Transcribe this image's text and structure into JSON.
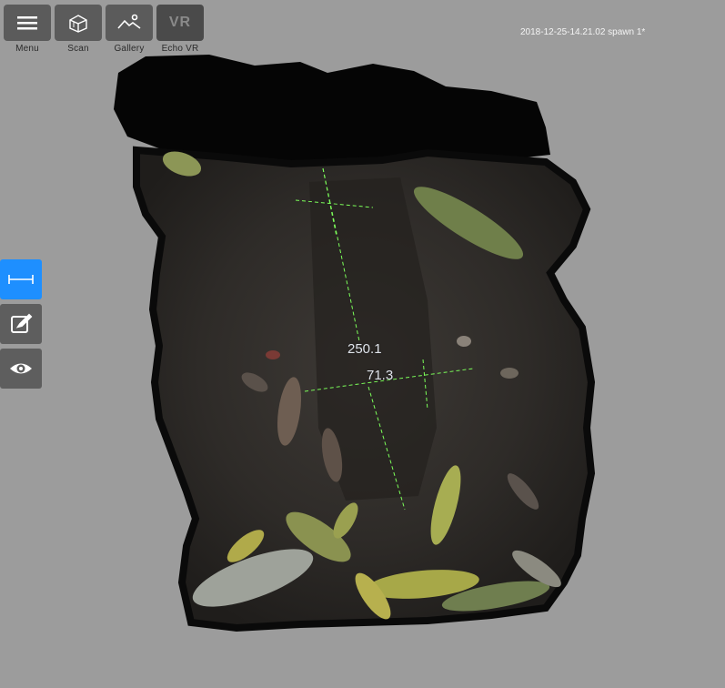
{
  "toolbar": {
    "items": [
      {
        "label": "Menu",
        "icon": "hamburger-menu-icon"
      },
      {
        "label": "Scan",
        "icon": "cube-scan-icon"
      },
      {
        "label": "Gallery",
        "icon": "gallery-landscape-icon"
      },
      {
        "label": "Echo VR",
        "icon": "vr-icon",
        "badge": "VR"
      }
    ]
  },
  "status": {
    "timestamp": "2018-12-25-14.21.02 spawn 1*"
  },
  "sidebar": {
    "tools": [
      {
        "icon": "ruler-measure-icon",
        "active": true
      },
      {
        "icon": "edit-note-icon",
        "active": false
      },
      {
        "icon": "eye-visibility-icon",
        "active": false
      }
    ]
  },
  "measurements": {
    "length": "250.1",
    "width": "71.3"
  },
  "colors": {
    "background": "#9c9c9c",
    "button": "#5b5b5b",
    "active_tool": "#1e8fff",
    "measure_line": "#7cff5a"
  }
}
